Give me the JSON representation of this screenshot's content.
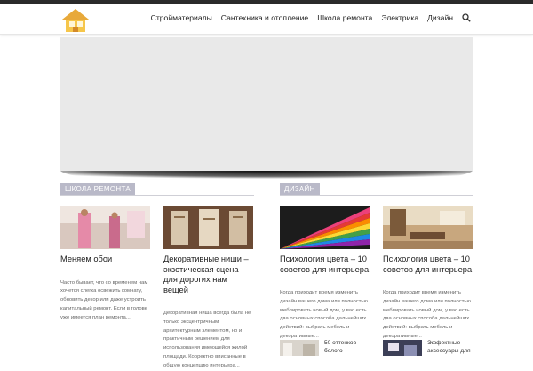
{
  "nav": {
    "items": [
      {
        "label": "Стройматериалы"
      },
      {
        "label": "Сантехника и отопление"
      },
      {
        "label": "Школа ремонта"
      },
      {
        "label": "Электрика"
      },
      {
        "label": "Дизайн"
      }
    ]
  },
  "sections": {
    "left": {
      "label": "ШКОЛА РЕМОНТА"
    },
    "right": {
      "label": "ДИЗАЙН"
    }
  },
  "cards": [
    {
      "title": "Меняем обои",
      "text": "Часто бывает, что со временем нам хочется слегка освежить комнату, обновить декор или даже устроить капитальный ремонт. Если в голове уже имеется план ремонта..."
    },
    {
      "title": "Декоративные ниши – экзотическая сцена для дорогих нам вещей",
      "text": "Декоративная ниша всегда была не только эксцентричным архитектурным элементом, но и практичным решением для использования имеющейся жилой площади. Корректно вписанные в общую концепцию интерьера..."
    },
    {
      "title": "Психология цвета – 10 советов для интерьера",
      "text": "Когда приходит время изменить дизайн вашего дома или полностью меблировать новый дом, у вас есть два основных способа дальнейших действий: выбрать мебель и декоративные..."
    },
    {
      "title": "Психология цвета – 10 советов для интерьера",
      "text": "Когда приходит время изменить дизайн вашего дома или полностью меблировать новый дом, у вас есть два основных способа дальнейших действий: выбрать мебель и декоративные..."
    }
  ],
  "mini": [
    {
      "title": "50 оттенков белого"
    },
    {
      "title": "Эффектные аксессуары для"
    }
  ],
  "colors": {
    "topbar": "#2b2b2b",
    "section_label_bg": "#b9b9c8",
    "slider_bg": "#e9e9e9"
  },
  "icons": {
    "search": "search-icon",
    "logo": "house-logo-icon"
  }
}
